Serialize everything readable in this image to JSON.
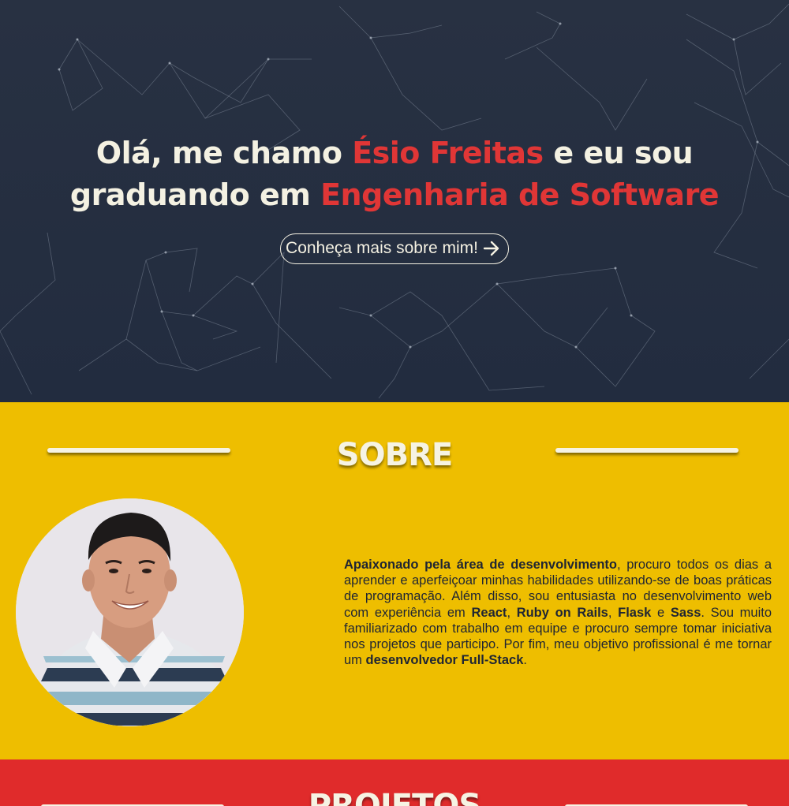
{
  "hero": {
    "line1_pre": "Olá, me chamo ",
    "line1_name": "Ésio Freitas",
    "line1_post": " e eu sou",
    "line2_pre": "graduando em ",
    "line2_course": "Engenharia de Software",
    "cta_label": "Conheça mais sobre mim!",
    "cta_icon": "arrow-right-icon"
  },
  "about": {
    "title": "SOBRE",
    "photo": "profile-photo",
    "p1_bold": "Apaixonado pela área de desenvolvimento",
    "p1_text": ", procuro todos os dias a aprender e aperfeiçoar minhas habilidades utilizando-se de boas práticas de programação. Além disso, sou entusiasta no desenvolvimento web com experiência em ",
    "tech1": "React",
    "sep1": ", ",
    "tech2": "Ruby on Rails",
    "sep2": ", ",
    "tech3": "Flask",
    "sep3": " e ",
    "tech4": "Sass",
    "p2_text": ". Sou muito familiarizado com trabalho em equipe e procuro sempre tomar iniciativa nos projetos que participo. Por fim, meu objetivo profissional é me tornar um ",
    "goal": "desenvolvedor Full-Stack",
    "end": "."
  },
  "projects": {
    "title": "PROJETOS"
  },
  "colors": {
    "hero_bg": "#262f40",
    "accent_red": "#e03636",
    "about_bg": "#eebe00",
    "projects_bg": "#e02b2b",
    "cream": "#f4f1e2",
    "text_dark": "#1f2533"
  }
}
